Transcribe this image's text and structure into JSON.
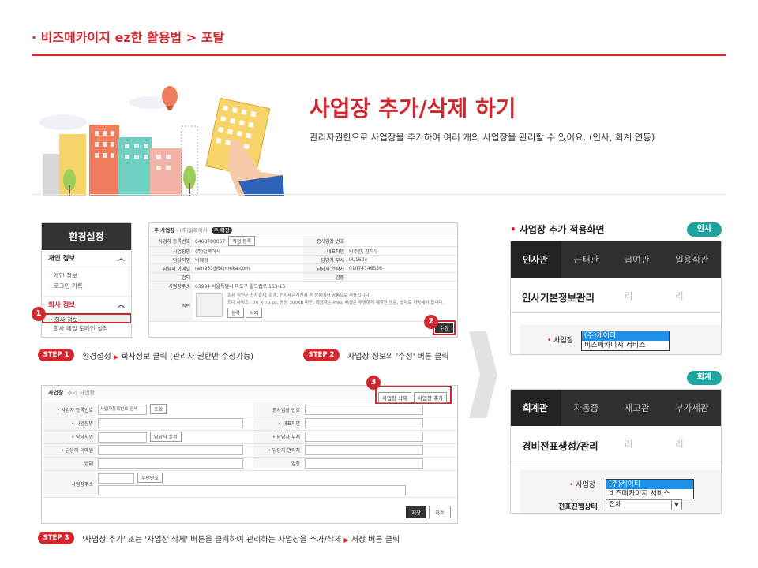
{
  "header": {
    "title": "· 비즈메카이지 ez한 활용법 > 포탈"
  },
  "hero": {
    "title": "사업장 추가/삭제 하기",
    "description": "관리자권한으로 사업장을 추가하여 여러 개의 사업장을 관리할 수 있어요. (인사, 회계 연동)"
  },
  "sidebar": {
    "title": "환경설정",
    "group1": "개인 정보",
    "items1": [
      "· 개인 정보",
      "· 로그인 기록"
    ],
    "group2": "회사 정보",
    "items2": [
      "· 회사 정보",
      "· 회사 메일 도메인 설정"
    ]
  },
  "step1": {
    "badge": "1",
    "label": "STEP 1",
    "text_a": "환경설정",
    "text_b": "회사정보 클릭 (관리자 권한만 수정가능)"
  },
  "step2": {
    "badge": "2",
    "label": "STEP 2",
    "text": "사업장 정보의 '수정' 버튼 클릭"
  },
  "step3": {
    "badge": "3",
    "label": "STEP 3",
    "text_a": "'사업장 추가' 또는 '사업장 삭제' 버튼을 클릭하여 관리하는 사업장을 추가/삭제",
    "text_b": "저장 버튼 클릭"
  },
  "info_form": {
    "title": "주 사업장",
    "subtitle": "- (주)일목이사",
    "tag": "주 확장",
    "rows": [
      {
        "l1": "사업자 등록번호",
        "v1": "6468700067",
        "btn": "직접 등록",
        "l2": "종사업장 번호",
        "v2": ""
      },
      {
        "l1": "사업장명",
        "v1": "(주)일목이사",
        "btn": "",
        "l2": "대표자명",
        "v2": "박주한, 강하우"
      },
      {
        "l1": "담당자명",
        "v1": "박혜정",
        "btn": "",
        "l2": "담당자 부서",
        "v2": "IR/1624"
      },
      {
        "l1": "담당자 이메일",
        "v1": "rain951@bizmeka.com",
        "btn": "",
        "l2": "담당자 연락처",
        "v2": "01074746526"
      },
      {
        "l1": "업태",
        "v1": "",
        "btn": "",
        "l2": "업종",
        "v2": ""
      },
      {
        "l1": "사업장주소",
        "v1": "03994 서울특별시 마포구 월드컵로 153-16",
        "btn": "",
        "l2": "",
        "v2": ""
      }
    ],
    "stamp_label": "직인",
    "stamp_text": "회사 직인은 전자결재, 회계, 전자세금계산서 등 상품에서 공통으로 사용됩니다.",
    "stamp_note": "최대 사이즈 : 70 × 70 px, 용량 300KB 미만, 확장자는 PNG, 배경은 투명하게 제작한 영문, 숫자로 저장해야 합니다.",
    "stamp_btns": [
      "등록",
      "삭제"
    ],
    "edit_btn": "수정"
  },
  "edit_form": {
    "title": "사업장",
    "subtitle": "추가 사업장",
    "delete_btn": "사업장 삭제",
    "add_btn": "사업장 추가",
    "rows": [
      {
        "l1": "사업자 등록번호",
        "v1": "사업자등록번호 검색",
        "btn": "조회",
        "l2": "종사업장 번호"
      },
      {
        "l1": "사업장명",
        "v1": "",
        "btn": "",
        "l2": "대표자명"
      },
      {
        "l1": "담당자명",
        "v1": "",
        "btn": "담당자 설정",
        "l2": "담당자 부서"
      },
      {
        "l1": "담당자 이메일",
        "v1": "",
        "btn": "",
        "l2": "담당자 연락처"
      },
      {
        "l1": "업태",
        "v1": "",
        "btn": "",
        "l2": "업종"
      }
    ],
    "addr_label": "사업장주소",
    "zip_btn": "우편번호",
    "save_btn": "저장",
    "cancel_btn": "취소"
  },
  "apply": {
    "title": "사업장 추가 적용화면",
    "hr_pill": "인사",
    "hr_tabs": [
      "인사관리",
      "근태관리",
      "급여관리",
      "일용직관리"
    ],
    "hr_heading": "인사기본정보관리",
    "acc_pill": "회계",
    "acc_tabs": [
      "회계관리",
      "자동증빙",
      "재고관리",
      "부가세관리"
    ],
    "acc_heading": "경비전표생성/관리",
    "field_label": "사업장",
    "options": [
      "(주)케이티",
      "비즈메카이지 서비스"
    ],
    "progress_label": "전표진행상태",
    "progress_value": "전체"
  }
}
